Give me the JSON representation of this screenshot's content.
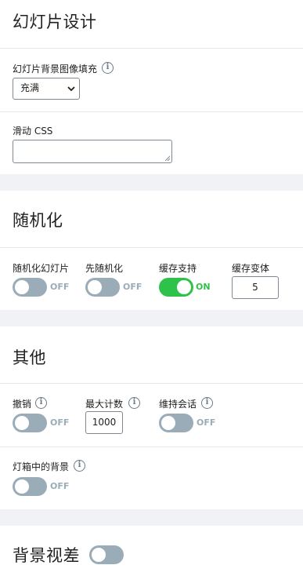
{
  "slide_design": {
    "title": "幻灯片设计",
    "bg_fill_label": "幻灯片背景图像填充",
    "bg_fill_value": "充满",
    "slide_css_label": "滑动 CSS",
    "slide_css_value": ""
  },
  "randomize": {
    "title": "随机化",
    "randomize_slides": {
      "label": "随机化幻灯片",
      "state": "OFF"
    },
    "randomize_first": {
      "label": "先随机化",
      "state": "OFF"
    },
    "cache_support": {
      "label": "缓存支持",
      "state": "ON"
    },
    "cache_variants": {
      "label": "缓存变体",
      "value": "5"
    }
  },
  "other": {
    "title": "其他",
    "undo": {
      "label": "撤销",
      "state": "OFF"
    },
    "max_count": {
      "label": "最大计数",
      "value": "1000"
    },
    "keep_session": {
      "label": "维持会话",
      "state": "OFF"
    },
    "lightbox_bg": {
      "label": "灯箱中的背景",
      "state": "OFF"
    }
  },
  "parallax": {
    "title": "背景视差",
    "state": "off"
  },
  "colors": {
    "toggle_off": "#9aacb8",
    "toggle_on": "#2ec24a",
    "divider": "#e3e6ea",
    "page_bg": "#f0f2f5"
  },
  "icons": {
    "info": "info-circle-icon",
    "select_chevron": "chevron-down-icon",
    "resize": "resize-grip-icon"
  }
}
